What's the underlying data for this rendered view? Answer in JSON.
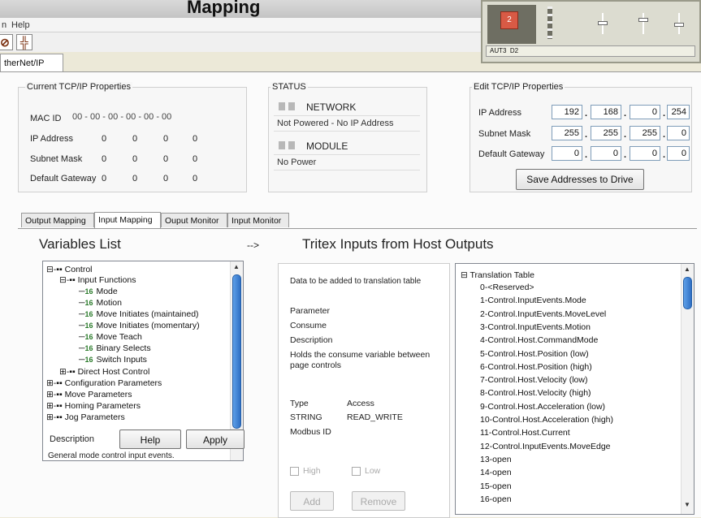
{
  "window": {
    "title": "Mapping"
  },
  "menu": {
    "items": [
      "n",
      "Help"
    ]
  },
  "tabs": {
    "main": "therNet/IP"
  },
  "current_tcpip": {
    "title": "Current TCP/IP Properties",
    "mac_label": "MAC ID",
    "mac_value": "00 - 00 - 00 - 00 - 00 - 00",
    "ip_label": "IP Address",
    "ip": [
      "0",
      "0",
      "0",
      "0"
    ],
    "subnet_label": "Subnet Mask",
    "subnet": [
      "0",
      "0",
      "0",
      "0"
    ],
    "gateway_label": "Default Gateway",
    "gateway": [
      "0",
      "0",
      "0",
      "0"
    ]
  },
  "status": {
    "title": "STATUS",
    "network_label": "NETWORK",
    "network_text": "Not Powered - No IP Address",
    "module_label": "MODULE",
    "module_text": "No Power"
  },
  "edit_tcpip": {
    "title": "Edit TCP/IP Properties",
    "ip_label": "IP Address",
    "ip": [
      "192",
      "168",
      "0",
      "254"
    ],
    "subnet_label": "Subnet Mask",
    "subnet": [
      "255",
      "255",
      "255",
      "0"
    ],
    "gateway_label": "Default Gateway",
    "gateway": [
      "0",
      "0",
      "0",
      "0"
    ],
    "save_button": "Save Addresses to Drive"
  },
  "subtabs": [
    "Output Mapping",
    "Input Mapping",
    "Ouput Monitor",
    "Input Monitor"
  ],
  "variables": {
    "title": "Variables List",
    "arrow": "-->",
    "tree": [
      "Control",
      "Input Functions",
      "Mode",
      "Motion",
      "Move Initiates (maintained)",
      "Move Initiates (momentary)",
      "Move Teach",
      "Binary Selects",
      "Switch Inputs",
      "Direct Host Control",
      "Configuration Parameters",
      "Move Parameters",
      "Homing Parameters",
      "Jog Parameters"
    ],
    "type_badge": "16",
    "description_label": "Description",
    "help_button": "Help",
    "apply_button": "Apply",
    "description_text": "General mode control input events."
  },
  "tritex": {
    "title": "Tritex Inputs from Host Outputs",
    "panel_heading": "Data to be added to translation table",
    "parameter_label": "Parameter",
    "parameter_value": "Consume",
    "description_label": "Description",
    "description_text": "Holds the consume variable between page controls",
    "type_label": "Type",
    "type_value": "STRING",
    "access_label": "Access",
    "access_value": "READ_WRITE",
    "modbus_label": "Modbus ID",
    "high_label": "High",
    "low_label": "Low",
    "add_button": "Add",
    "remove_button": "Remove"
  },
  "translation": {
    "root": "Translation Table",
    "items": [
      "0-<Reserved>",
      "1-Control.InputEvents.Mode",
      "2-Control.InputEvents.MoveLevel",
      "3-Control.InputEvents.Motion",
      "4-Control.Host.CommandMode",
      "5-Control.Host.Position (low)",
      "6-Control.Host.Position (high)",
      "7-Control.Host.Velocity (low)",
      "8-Control.Host.Velocity (high)",
      "9-Control.Host.Acceleration (low)",
      "10-Control.Host.Acceleration (high)",
      "11-Control.Host.Current",
      "12-Control.InputEvents.MoveEdge",
      "13-open",
      "14-open",
      "15-open",
      "16-open"
    ]
  },
  "inset": {
    "button_label": "2",
    "status_left": "AUT3",
    "status_right": "D2"
  }
}
